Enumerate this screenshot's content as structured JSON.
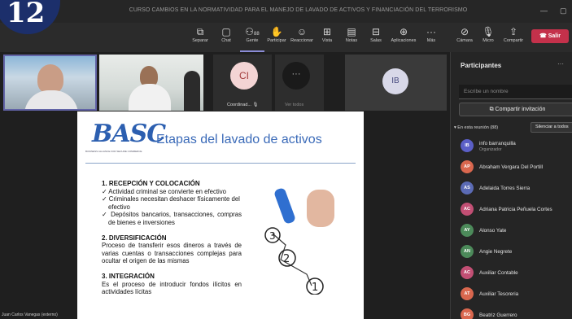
{
  "badge": "12",
  "window": {
    "title": "CURSO CAMBIOS EN LA NORMATIVIDAD PARA EL MANEJO DE LAVADO DE ACTIVOS Y FINANCIACIÓN DEL TERRORISMO",
    "minimize": "—",
    "restore": "▢"
  },
  "toolbar": {
    "buttons": [
      {
        "label": "Separar",
        "icon": "separate-icon"
      },
      {
        "label": "Chat",
        "icon": "chat-icon"
      },
      {
        "label": "Gente",
        "icon": "people-icon",
        "count": "88"
      },
      {
        "label": "Participar",
        "icon": "raise-hand-icon"
      },
      {
        "label": "Reaccionar",
        "icon": "react-icon"
      },
      {
        "label": "Vista",
        "icon": "view-icon"
      },
      {
        "label": "Notas",
        "icon": "notes-icon"
      },
      {
        "label": "Salas",
        "icon": "rooms-icon"
      },
      {
        "label": "Aplicaciones",
        "icon": "apps-icon"
      },
      {
        "label": "Más",
        "icon": "more-icon"
      },
      {
        "label": "Cámara",
        "icon": "camera-off-icon"
      },
      {
        "label": "Micro",
        "icon": "mic-off-icon"
      },
      {
        "label": "Compartir",
        "icon": "share-icon"
      }
    ],
    "leave_label": "Salir",
    "leave_color": "#c4314b"
  },
  "stage": {
    "coordinator_initials": "CI",
    "coordinator_name": "Coordinad...",
    "others_label": "Ver todos",
    "ib_initials": "IB",
    "presenter_name": "Juan Carlos Vanegas (externo)"
  },
  "slide": {
    "logo": "BASC",
    "logo_sub": "BUSINESS ALLIANCE FOR SECURE COMMERCE",
    "title": "Etapas del lavado de activos",
    "section1": "1. RECEPCIÓN Y COLOCACIÓN",
    "bullets": [
      "Actividad criminal se convierte en efectivo",
      "Criminales necesitan deshacer físicamente del efectivo",
      "Depósitos bancarios, transacciones, compras de bienes e inversiones"
    ],
    "section2": "2. DIVERSIFICACIÓN",
    "text2": "Proceso de transferir esos dineros a través de varias cuentas o transacciones complejas para ocultar el origen de las mismas",
    "section3": "3. INTEGRACIÓN",
    "text3": "Es el proceso de introducir fondos ilícitos en actividades lícitas",
    "step_numbers": [
      "3",
      "2",
      "1"
    ]
  },
  "panel": {
    "title": "Participantes",
    "more": "···",
    "search_placeholder": "Escribe un nombre",
    "invite_label": "Compartir invitación",
    "section_label": "En esta reunión (88)",
    "mute_all_label": "Silenciar a todos",
    "participants": [
      {
        "initials": "IB",
        "name": "info barranquilla",
        "role": "Organizador",
        "color": "#5b5fc7"
      },
      {
        "initials": "AP",
        "name": "Abraham Vergara Del Portill",
        "color": "#d9674e"
      },
      {
        "initials": "AS",
        "name": "Adelaida Torres Sierra",
        "color": "#5b6bb5"
      },
      {
        "initials": "AC",
        "name": "Adriana Patricia Peñuela Cortes",
        "color": "#c24f74"
      },
      {
        "initials": "AY",
        "name": "Alonso Yate",
        "color": "#4c8a5a"
      },
      {
        "initials": "AN",
        "name": "Angie Negrete",
        "color": "#4c8a5a"
      },
      {
        "initials": "AC",
        "name": "Auxiliar Contable",
        "color": "#c24f74"
      },
      {
        "initials": "AT",
        "name": "Auxiliar Tesoreria",
        "color": "#d9674e"
      },
      {
        "initials": "BG",
        "name": "Beatriz Guerrero",
        "color": "#d9674e"
      }
    ]
  }
}
